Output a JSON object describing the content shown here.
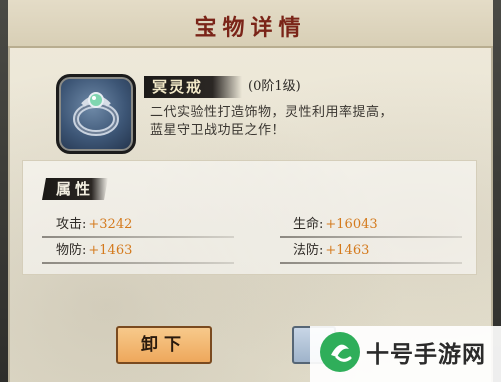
{
  "dialog": {
    "title": "宝物详情"
  },
  "item": {
    "name": "冥灵戒",
    "level": "(0阶1级)",
    "desc_line1": "二代实验性打造饰物，灵性利用率提高，",
    "desc_line2": "蓝星守卫战功臣之作！",
    "icon": "ring-icon"
  },
  "attributes": {
    "header": "属性",
    "stats": [
      {
        "label": "攻击:",
        "value": "+3242"
      },
      {
        "label": "生命:",
        "value": "+16043"
      },
      {
        "label": "物防:",
        "value": "+1463"
      },
      {
        "label": "法防:",
        "value": "+1463"
      }
    ]
  },
  "buttons": {
    "unequip": "卸下"
  },
  "watermark": {
    "text": "十号手游网"
  },
  "colors": {
    "title": "#7a2418",
    "stat_value": "#d47a1d",
    "unequip_button": "#eea85c"
  }
}
